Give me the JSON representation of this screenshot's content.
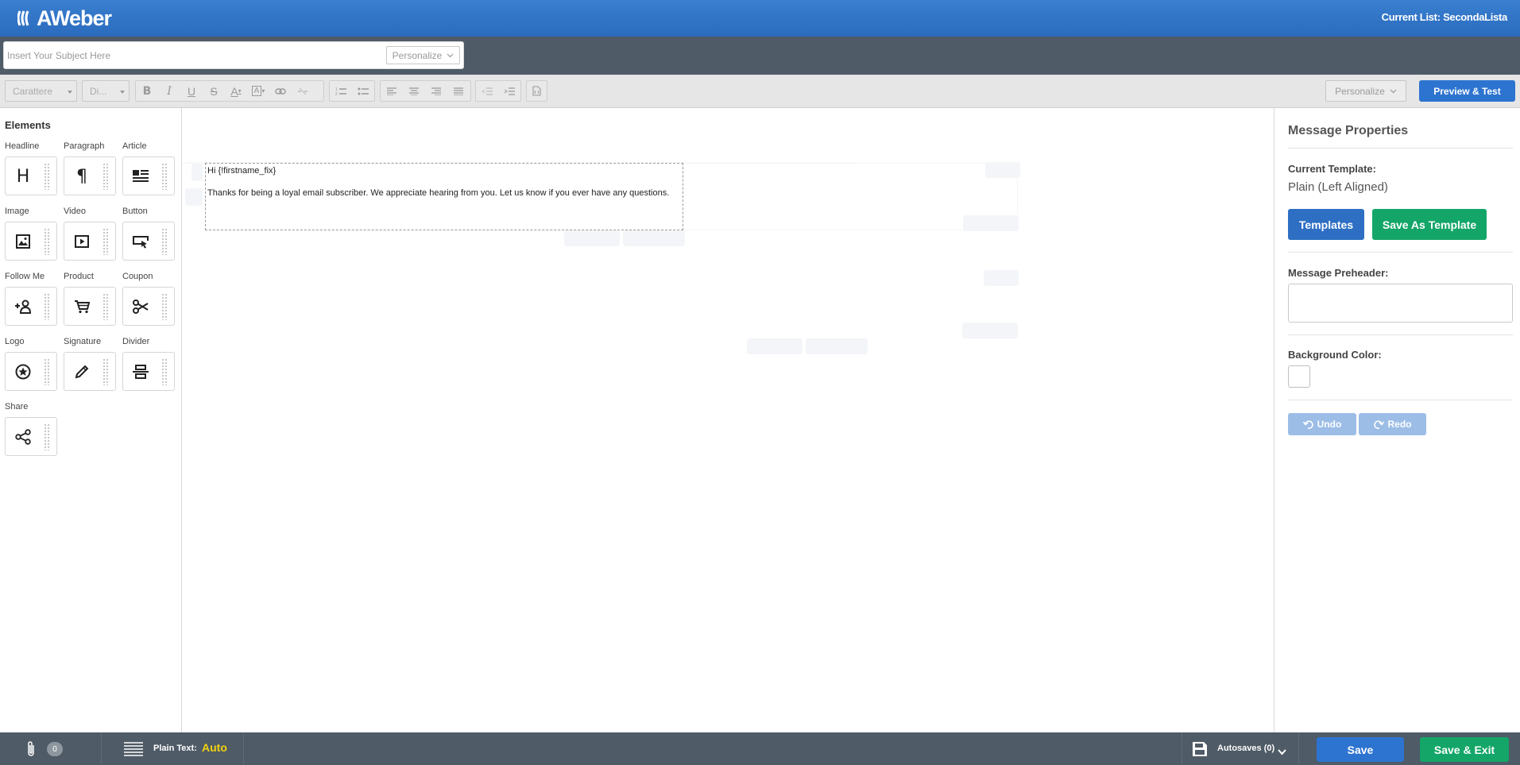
{
  "header": {
    "logo_text": "AWeber",
    "current_list_label": "Current List:",
    "current_list_value": "SecondaLista"
  },
  "subject": {
    "placeholder": "Insert Your Subject Here",
    "value": "",
    "personalize_label": "Personalize"
  },
  "toolbar": {
    "font_select": "Carattere",
    "size_select": "Di...",
    "personalize_label": "Personalize",
    "preview_label": "Preview & Test"
  },
  "elements": {
    "title": "Elements",
    "items": [
      {
        "label": "Headline",
        "icon": "headline-icon"
      },
      {
        "label": "Paragraph",
        "icon": "paragraph-icon"
      },
      {
        "label": "Article",
        "icon": "article-icon"
      },
      {
        "label": "Image",
        "icon": "image-icon"
      },
      {
        "label": "Video",
        "icon": "video-icon"
      },
      {
        "label": "Button",
        "icon": "button-icon"
      },
      {
        "label": "Follow Me",
        "icon": "follow-me-icon"
      },
      {
        "label": "Product",
        "icon": "cart-icon"
      },
      {
        "label": "Coupon",
        "icon": "scissors-icon"
      },
      {
        "label": "Logo",
        "icon": "logo-star-icon"
      },
      {
        "label": "Signature",
        "icon": "pen-icon"
      },
      {
        "label": "Divider",
        "icon": "divider-icon"
      },
      {
        "label": "Share",
        "icon": "share-icon"
      }
    ]
  },
  "email": {
    "greeting": "Hi {!firstname_fix}",
    "body": "Thanks for being a loyal email subscriber. We appreciate hearing from you. Let us know if you ever have any questions."
  },
  "properties": {
    "title": "Message Properties",
    "current_template_label": "Current Template:",
    "current_template_value": "Plain (Left Aligned)",
    "templates_button": "Templates",
    "save_as_template_button": "Save As Template",
    "preheader_label": "Message Preheader:",
    "preheader_value": "",
    "background_color_label": "Background Color:",
    "background_color_value": "#ffffff",
    "undo_label": "Undo",
    "redo_label": "Redo"
  },
  "footer": {
    "attachments_count": "0",
    "plain_text_label": "Plain Text:",
    "plain_text_value": "Auto",
    "autosaves_label": "Autosaves (0)",
    "save_label": "Save",
    "save_exit_label": "Save & Exit"
  },
  "colors": {
    "brand_blue": "#2d74d0",
    "green": "#13a668",
    "dark_bar": "#4f5b66",
    "plain_text_accent": "#f2d20f"
  }
}
